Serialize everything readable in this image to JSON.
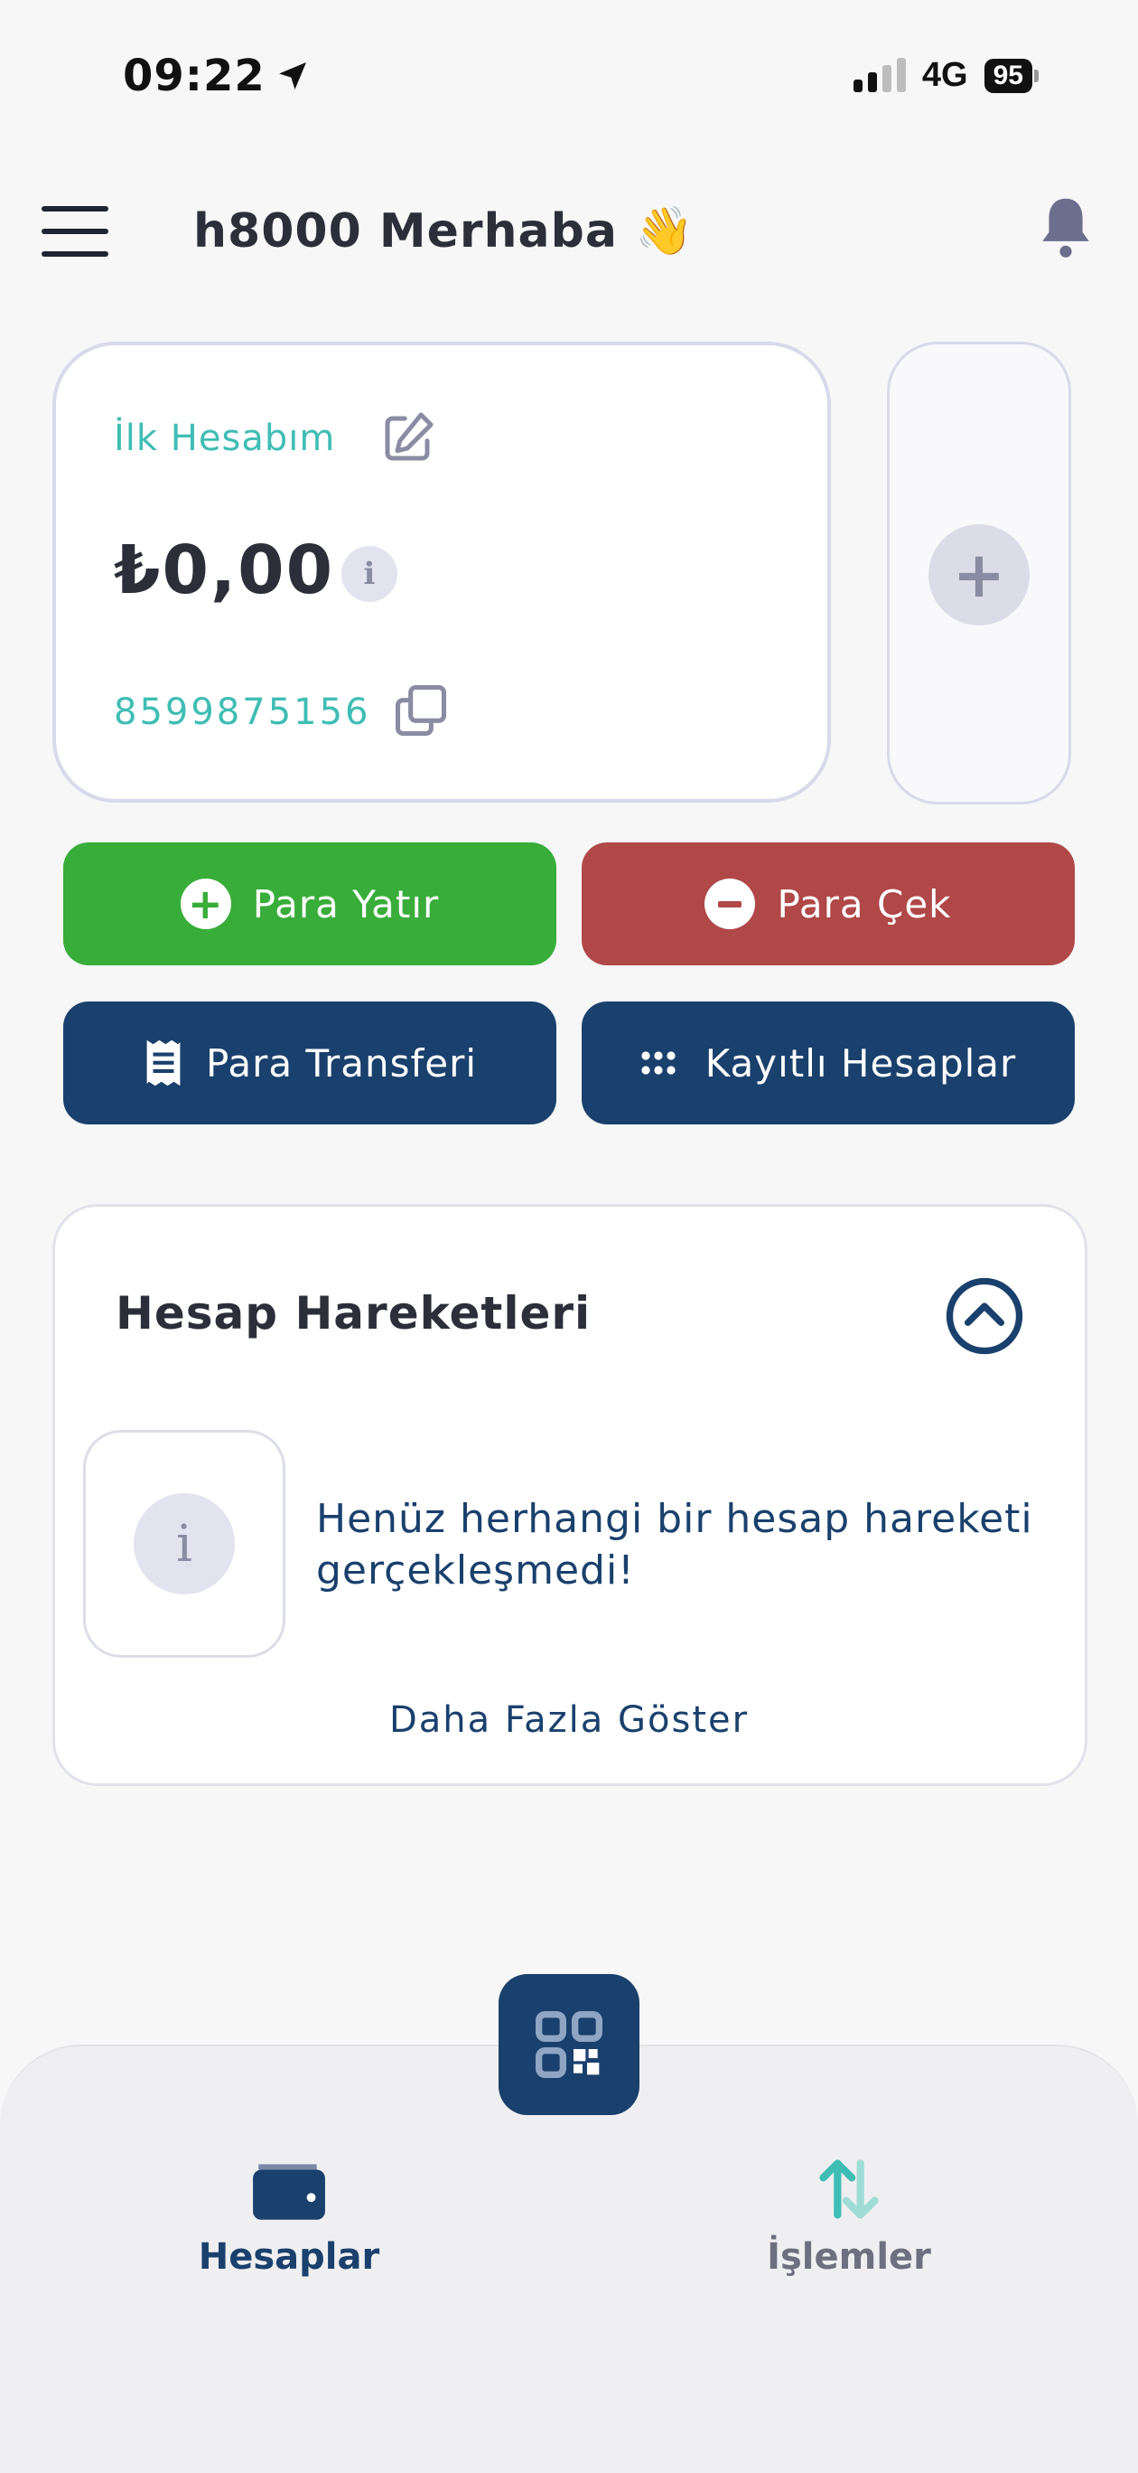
{
  "status_bar": {
    "time": "09:22",
    "network": "4G",
    "battery": "95"
  },
  "header": {
    "greeting": "h8000 Merhaba",
    "emoji": "👋"
  },
  "account": {
    "name": "İlk Hesabım",
    "balance": "₺0,00",
    "number": "8599875156"
  },
  "actions": {
    "deposit": "Para Yatır",
    "withdraw": "Para Çek",
    "transfer": "Para Transferi",
    "saved_accounts": "Kayıtlı Hesaplar"
  },
  "transactions": {
    "title": "Hesap Hareketleri",
    "empty_message": "Henüz herhangi bir hesap hareketi gerçekleşmedi!",
    "show_more": "Daha Fazla Göster"
  },
  "bottom_nav": {
    "accounts": "Hesaplar",
    "transactions": "İşlemler"
  },
  "colors": {
    "green": "#38ad3a",
    "red": "#b04848",
    "navy": "#1a406d",
    "teal": "#3fbdb4"
  }
}
